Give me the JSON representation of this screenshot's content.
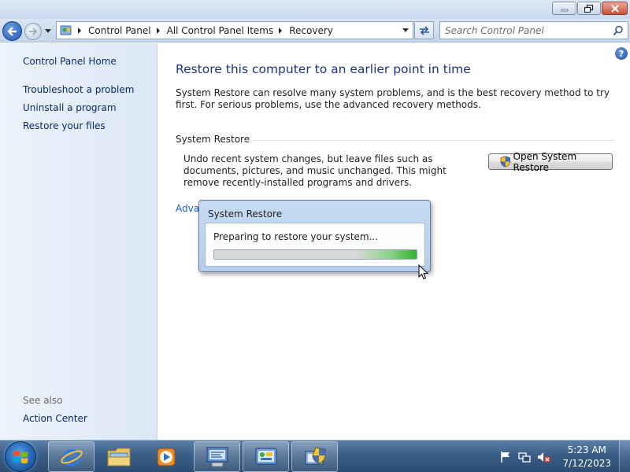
{
  "window": {
    "minimize_label": "Minimize",
    "maximize_label": "Restore Down",
    "close_label": "Close"
  },
  "nav": {
    "breadcrumbs": [
      "Control Panel",
      "All Control Panel Items",
      "Recovery"
    ],
    "search_placeholder": "Search Control Panel"
  },
  "sidebar": {
    "home_label": "Control Panel Home",
    "links": [
      "Troubleshoot a problem",
      "Uninstall a program",
      "Restore your files"
    ],
    "see_also_label": "See also",
    "see_also_links": [
      "Action Center"
    ]
  },
  "main": {
    "help_glyph": "?",
    "title": "Restore this computer to an earlier point in time",
    "description": "System Restore can resolve many system problems, and is the best recovery method to try first. For serious problems, use the advanced recovery methods.",
    "section_label": "System Restore",
    "restore_description": "Undo recent system changes, but leave files such as documents, pictures, and music unchanged. This might remove recently-installed programs and drivers.",
    "open_restore_button": "Open System Restore",
    "advanced_link": "Adva"
  },
  "dialog": {
    "title": "System Restore",
    "message": "Preparing to restore your system...",
    "progress_fraction": 1.0
  },
  "taskbar": {
    "items": [
      "internet-explorer",
      "windows-explorer",
      "windows-media-player",
      "remote-desktop",
      "control-panel",
      "system-restore"
    ],
    "clock_time": "5:23 AM",
    "clock_date": "7/12/2023"
  },
  "colors": {
    "title_blue": "#1e3287",
    "link_blue": "#1a5dc7",
    "progress_green": "#31b230",
    "taskbar_blue": "#3b5e86"
  }
}
